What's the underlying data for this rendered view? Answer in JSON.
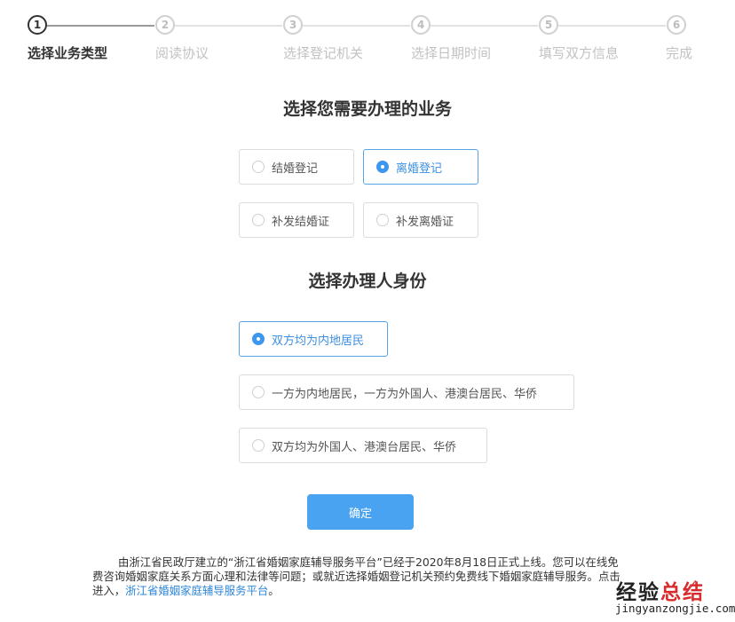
{
  "stepper": {
    "current": 1,
    "steps": [
      {
        "number": "1",
        "label": "选择业务类型"
      },
      {
        "number": "2",
        "label": "阅读协议"
      },
      {
        "number": "3",
        "label": "选择登记机关"
      },
      {
        "number": "4",
        "label": "选择日期时间"
      },
      {
        "number": "5",
        "label": "填写双方信息"
      },
      {
        "number": "6",
        "label": "完成"
      }
    ]
  },
  "business": {
    "title": "选择您需要办理的业务",
    "selected": "离婚登记",
    "options": [
      "结婚登记",
      "离婚登记",
      "补发结婚证",
      "补发离婚证"
    ]
  },
  "identity": {
    "title": "选择办理人身份",
    "selected": "双方均为内地居民",
    "options": [
      "双方均为内地居民",
      "一方为内地居民，一方为外国人、港澳台居民、华侨",
      "双方均为外国人、港澳台居民、华侨"
    ]
  },
  "confirm_label": "确定",
  "notice": {
    "text": "由浙江省民政厅建立的“浙江省婚姻家庭辅导服务平台”已经于2020年8月18日正式上线。您可以在线免费咨询婚姻家庭关系方面心理和法律等问题；或就近选择婚姻登记机关预约免费线下婚姻家庭辅导服务。点击进入，",
    "link": "浙江省婚姻家庭辅导服务平台",
    "end": "。"
  },
  "watermark": {
    "title_plain": "经验",
    "title_accent": "总结",
    "url": "jingyanzongjie.com"
  },
  "colors": {
    "accent": "#4aa3f0",
    "selected_text": "#3d8fe0",
    "link": "#2d86d9",
    "watermark_red": "#d92b2b"
  }
}
